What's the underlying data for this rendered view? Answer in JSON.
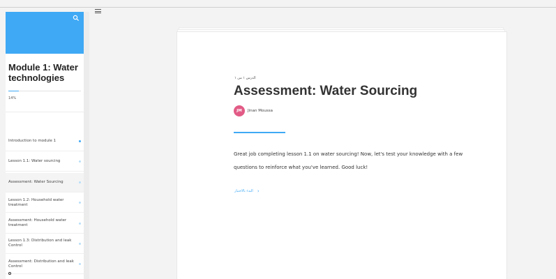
{
  "sidebar": {
    "module_title": "Module 1: Water technologies",
    "progress_percent": 14,
    "progress_text": "14%",
    "lessons": [
      {
        "label": "Introduction to module 1",
        "done": true,
        "active": false
      },
      {
        "label": "Lesson 1.1: Water sourcing",
        "done": false,
        "active": false
      },
      {
        "label": "Assessment: Water Sourcing",
        "done": false,
        "active": true
      },
      {
        "label": "Lesson 1.2: Household water treatment",
        "done": false,
        "active": false
      },
      {
        "label": "Assessment: Household water treatment",
        "done": false,
        "active": false
      },
      {
        "label": "Lesson 1.3: Distribution and leak Control",
        "done": false,
        "active": false
      },
      {
        "label": "Assessment: Distribution and leak Control",
        "done": false,
        "active": false
      }
    ]
  },
  "main": {
    "kicker": "الدرس ١ من ١",
    "title": "Assessment: Water Sourcing",
    "author_initials": "JM",
    "author_name": "Jinan Moussa",
    "paragraph": "Great job completing lesson 1.1 on water sourcing! Now, let's test your knowledge with a few questions to reinforce what you've learned. Good luck!",
    "continue_label": "البدء بالاختبار",
    "continue_chevron": "›"
  },
  "colors": {
    "accent": "#3fa9f5",
    "avatar": "#e25b86"
  },
  "icons": {
    "banner": "search-icon",
    "menu": "hamburger-menu-icon",
    "continue": "chevron-right-icon"
  }
}
